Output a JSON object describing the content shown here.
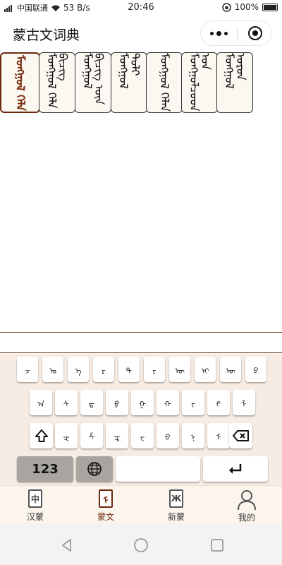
{
  "status_bar": {
    "carrier": "中国联通",
    "speed": "53 B/s",
    "time": "20:46",
    "battery": "100%"
  },
  "header": {
    "title": "蒙古文词典"
  },
  "results": {
    "cards": [
      {
        "text": "ᠮᠣᠩᠭᠣᠯ ᠬᠡᠯᠡ",
        "active": true
      },
      {
        "text": "ᠮᠣᠩᠭᠣᠯ ᠬᠡᠯᠡ ᠪᠢᠴᠢᠭ",
        "active": false
      },
      {
        "text": "ᠮᠣᠩᠭᠣᠯ ᠪᠢᠴᠢᠭ ᠦᠨ",
        "active": false
      },
      {
        "text": "ᠮᠣᠩᠭᠣᠯ ᠲᠣᠯᠢ",
        "active": false
      },
      {
        "text": "ᠮᠣᠩᠭᠣᠯ ᠬᠡᠯᠡᠨ",
        "active": false
      },
      {
        "text": "ᠮᠣᠩᠭᠣᠯᠴᠤᠳ ᠤᠨ",
        "active": false
      },
      {
        "text": "ᠮᠣᠩᠭᠣᠯ ᠣᠷᠣᠨ",
        "active": false
      }
    ]
  },
  "keyboard": {
    "row1": [
      "ᠴ",
      "ᠣ",
      "ᠡ",
      "ᠷ",
      "ᠲ",
      "ᠶ",
      "ᠦ",
      "ᠢ",
      "ᠥ",
      "ᠫ"
    ],
    "row2": [
      "ᠠ",
      "ᠰ",
      "ᠳ",
      "ᠹ",
      "ᠭ",
      "ᠬ",
      "ᠵ",
      "ᠻ",
      "ᠯ"
    ],
    "row3": [
      "ᠽ",
      "ᠱ",
      "ᠼ",
      "ᠸ",
      "ᠪ",
      "ᠨ",
      "ᠮ"
    ],
    "num_label": "123",
    "icons": {
      "shift": "shift-icon",
      "backspace": "backspace-icon",
      "globe": "globe-icon",
      "enter": "enter-icon"
    }
  },
  "tabs": [
    {
      "label": "汉蒙",
      "glyph": "中",
      "active": false
    },
    {
      "label": "蒙文",
      "glyph": "ᠮ",
      "active": true
    },
    {
      "label": "新蒙",
      "glyph": "Ж",
      "active": false
    },
    {
      "label": "我的",
      "glyph": "",
      "active": false
    }
  ],
  "colors": {
    "accent": "#7a2e10",
    "keyboard_bg": "#f7ece3"
  }
}
